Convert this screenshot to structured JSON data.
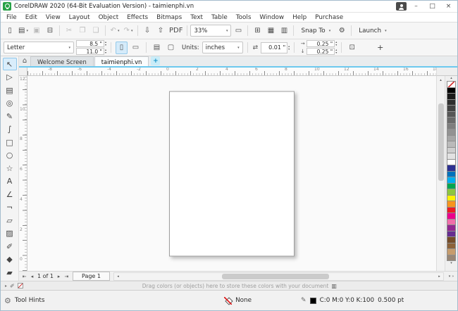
{
  "window": {
    "title": "CorelDRAW 2020 (64-Bit Evaluation Version) - taimienphi.vn"
  },
  "icons": {
    "minimize": "–",
    "maximize": "□",
    "close": "×",
    "chevron_down": "▾",
    "spin_up": "▴",
    "spin_down": "▾",
    "portrait": "▯",
    "landscape": "▭",
    "all_pages": "▤",
    "current_page": "▢",
    "nudge": "⇄",
    "dup_x": "→",
    "dup_y": "↓",
    "treat_filled": "⊡",
    "plus": "+",
    "home": "⌂",
    "up": "▴",
    "down": "▾",
    "left": "◂",
    "right": "▸",
    "first": "⇤",
    "prev": "◂",
    "next": "▸",
    "last": "⇥",
    "gear": "⚙",
    "pen": "✎",
    "eyedropper": "✐",
    "palette_options": "▥",
    "flyout_more": "»"
  },
  "menu": {
    "items": [
      "File",
      "Edit",
      "View",
      "Layout",
      "Object",
      "Effects",
      "Bitmaps",
      "Text",
      "Table",
      "Tools",
      "Window",
      "Help",
      "Purchase"
    ]
  },
  "toolbar": {
    "items": [
      {
        "t": "btn",
        "name": "new-document",
        "g": "▯"
      },
      {
        "t": "btn",
        "name": "open",
        "g": "▤",
        "arrow": true
      },
      {
        "t": "btn",
        "name": "save",
        "g": "▣",
        "dis": true
      },
      {
        "t": "btn",
        "name": "print",
        "g": "⊟"
      },
      {
        "t": "sep"
      },
      {
        "t": "btn",
        "name": "cut",
        "g": "✂",
        "dis": true
      },
      {
        "t": "btn",
        "name": "copy",
        "g": "❐",
        "dis": true
      },
      {
        "t": "btn",
        "name": "paste",
        "g": "❑",
        "dis": true
      },
      {
        "t": "sep"
      },
      {
        "t": "btn",
        "name": "undo",
        "g": "↶",
        "arrow": true,
        "dis": true
      },
      {
        "t": "btn",
        "name": "redo",
        "g": "↷",
        "arrow": true,
        "dis": true
      },
      {
        "t": "sep"
      },
      {
        "t": "btn",
        "name": "import",
        "g": "⇩"
      },
      {
        "t": "btn",
        "name": "export",
        "g": "⇧"
      },
      {
        "t": "btn",
        "name": "publish-to-pdf",
        "g": "PDF"
      },
      {
        "t": "sep"
      },
      {
        "t": "combo",
        "name": "zoom-level",
        "value": "33%"
      },
      {
        "t": "btn",
        "name": "full-screen-preview",
        "g": "▭"
      },
      {
        "t": "sep"
      },
      {
        "t": "btn",
        "name": "show-rulers",
        "g": "⊞"
      },
      {
        "t": "btn",
        "name": "show-grid",
        "g": "▦"
      },
      {
        "t": "btn",
        "name": "show-guidelines",
        "g": "▥"
      },
      {
        "t": "sep"
      },
      {
        "t": "drop",
        "name": "snap-to",
        "label": "Snap To"
      },
      {
        "t": "btn",
        "name": "options",
        "g": "⚙"
      },
      {
        "t": "sep"
      },
      {
        "t": "drop",
        "name": "launch",
        "label": "Launch"
      }
    ]
  },
  "property_bar": {
    "page_size_value": "Letter",
    "width_value": "8.5 \"",
    "height_value": "11.0 \"",
    "units_label": "Units:",
    "units_value": "inches",
    "nudge_value": "0.01 \"",
    "dup_x_value": "0.25 \"",
    "dup_y_value": "0.25 \""
  },
  "document_tabs": {
    "tabs": [
      {
        "label": "Welcome Screen"
      },
      {
        "label": "taimienphi.vn"
      }
    ],
    "active_index": 1
  },
  "rulers": {
    "horizontal": [
      "-8",
      "-6",
      "-4",
      "-2",
      "0",
      "2",
      "4",
      "6",
      "8",
      "10",
      "12",
      "14",
      "16",
      "18"
    ],
    "vertical": [
      "12",
      "10",
      "8",
      "6",
      "4",
      "2",
      "0"
    ]
  },
  "toolbox": {
    "tools": [
      {
        "name": "pick",
        "glyph": "↖",
        "selected": true
      },
      {
        "name": "shape",
        "glyph": "▷"
      },
      {
        "name": "crop",
        "glyph": "▤"
      },
      {
        "name": "zoom",
        "glyph": "◎"
      },
      {
        "name": "freehand",
        "glyph": "✎"
      },
      {
        "name": "artistic-media",
        "glyph": "∫"
      },
      {
        "name": "rectangle",
        "glyph": "□"
      },
      {
        "name": "ellipse",
        "glyph": "○"
      },
      {
        "name": "polygon",
        "glyph": "☆"
      },
      {
        "name": "text",
        "glyph": "A"
      },
      {
        "name": "parallel-dimension",
        "glyph": "∠"
      },
      {
        "name": "connector",
        "glyph": "¬"
      },
      {
        "name": "drop-shadow",
        "glyph": "▱"
      },
      {
        "name": "transparency",
        "glyph": "▨"
      },
      {
        "name": "color-eyedropper",
        "glyph": "✐"
      },
      {
        "name": "interactive-fill",
        "glyph": "◆"
      },
      {
        "name": "smart-fill",
        "glyph": "▰"
      }
    ]
  },
  "color_palette": {
    "colors": [
      "none",
      "#000000",
      "#1a1a1a",
      "#2e2e2e",
      "#424242",
      "#565656",
      "#6a6a6a",
      "#7e7e7e",
      "#929292",
      "#a6a6a6",
      "#bababa",
      "#cecece",
      "#e2e2e2",
      "#ffffff",
      "#2e3192",
      "#0072bc",
      "#00aeef",
      "#00a651",
      "#8dc63f",
      "#fff200",
      "#f7941d",
      "#ed1c24",
      "#ec008c",
      "#f06eaa",
      "#92278f",
      "#662d91",
      "#754c29",
      "#8c6239",
      "#c69c6d",
      "#998675"
    ]
  },
  "page_navigation": {
    "position": "1 of 1",
    "page_tab": "Page 1"
  },
  "hint_bar": {
    "text": "Drag colors (or objects) here to store these colors with your document"
  },
  "status_bar": {
    "tool_hints": "Tool Hints",
    "fill_value": "None",
    "outline_cmyk": "C:0 M:0 Y:0 K:100",
    "outline_width": "0.500 pt"
  }
}
